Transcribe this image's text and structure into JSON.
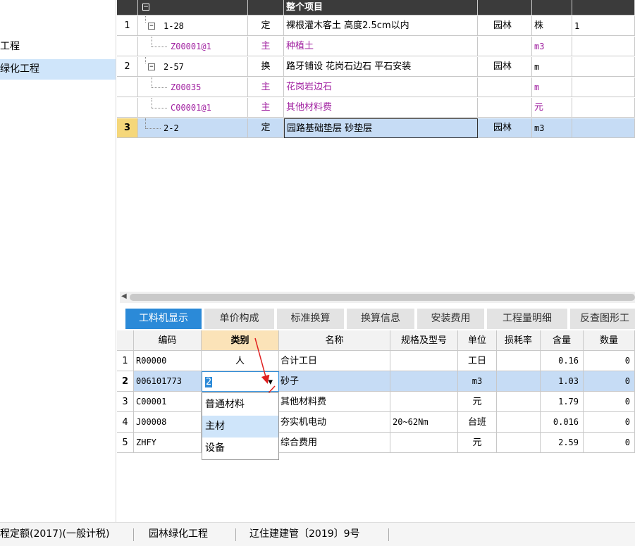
{
  "left_panel": {
    "items": [
      {
        "label": "工程"
      },
      {
        "label": "绿化工程"
      }
    ]
  },
  "top_grid": {
    "header_row": {
      "name": "整个项目"
    },
    "rows": [
      {
        "num": "1",
        "code": "1-28",
        "type": "定",
        "name": "裸根灌木客土 高度2.5cm以内",
        "spec": "园林",
        "unit": "株",
        "qty": "1",
        "tree": "minus",
        "sub": false
      },
      {
        "num": "",
        "code": "Z00001@1",
        "type": "主",
        "name": "种植土",
        "spec": "",
        "unit": "m3",
        "qty": "",
        "tree": "",
        "sub": true
      },
      {
        "num": "2",
        "code": "2-57",
        "type": "换",
        "name": "路牙铺设 花岗石边石 平石安装",
        "spec": "园林",
        "unit": "m",
        "qty": "",
        "tree": "minus",
        "sub": false
      },
      {
        "num": "",
        "code": "Z00035",
        "type": "主",
        "name": "花岗岩边石",
        "spec": "",
        "unit": "m",
        "qty": "",
        "tree": "",
        "sub": true
      },
      {
        "num": "",
        "code": "C00001@1",
        "type": "主",
        "name": "其他材料费",
        "spec": "",
        "unit": "元",
        "qty": "",
        "tree": "",
        "sub": true
      },
      {
        "num": "3",
        "code": "2-2",
        "type": "定",
        "name": "园路基础垫层 砂垫层",
        "spec": "园林",
        "unit": "m3",
        "qty": "",
        "tree": "",
        "sub": false,
        "selected": true
      }
    ]
  },
  "tabs": [
    {
      "label": "工料机显示",
      "active": true
    },
    {
      "label": "单价构成"
    },
    {
      "label": "标准换算"
    },
    {
      "label": "换算信息"
    },
    {
      "label": "安装费用"
    },
    {
      "label": "工程量明细"
    },
    {
      "label": "反查图形工"
    }
  ],
  "bottom_grid": {
    "headers": [
      "编码",
      "类别",
      "名称",
      "规格及型号",
      "单位",
      "损耗率",
      "含量",
      "数量"
    ],
    "rows": [
      {
        "num": "1",
        "code": "R00000",
        "category": "人",
        "name": "合计工日",
        "spec": "",
        "unit": "工日",
        "loss": "",
        "content": "0.16",
        "qty": "0"
      },
      {
        "num": "2",
        "code": "006101773",
        "category": "2",
        "name": "砂子",
        "spec": "",
        "unit": "m3",
        "loss": "",
        "content": "1.03",
        "qty": "0",
        "selected": true
      },
      {
        "num": "3",
        "code": "C00001",
        "category": "",
        "name": "其他材料费",
        "spec": "",
        "unit": "元",
        "loss": "",
        "content": "1.79",
        "qty": "0"
      },
      {
        "num": "4",
        "code": "J00008",
        "category": "",
        "name": "夯实机电动",
        "spec": "20~62Nm",
        "unit": "台班",
        "loss": "",
        "content": "0.016",
        "qty": "0"
      },
      {
        "num": "5",
        "code": "ZHFY",
        "category": "",
        "name": "综合费用",
        "spec": "",
        "unit": "元",
        "loss": "",
        "content": "2.59",
        "qty": "0"
      }
    ]
  },
  "dropdown": {
    "options": [
      "普通材料",
      "主材",
      "设备"
    ],
    "highlighted": "主材"
  },
  "status_bar": {
    "items": [
      "程定额(2017)(一般计税)",
      "园林绿化工程",
      "辽住建建管〔2019〕9号"
    ]
  },
  "colors": {
    "accent": "#2b8ad8",
    "selection": "#c6dcf5",
    "sub_text": "#a020a0",
    "arrow": "#e02020"
  }
}
